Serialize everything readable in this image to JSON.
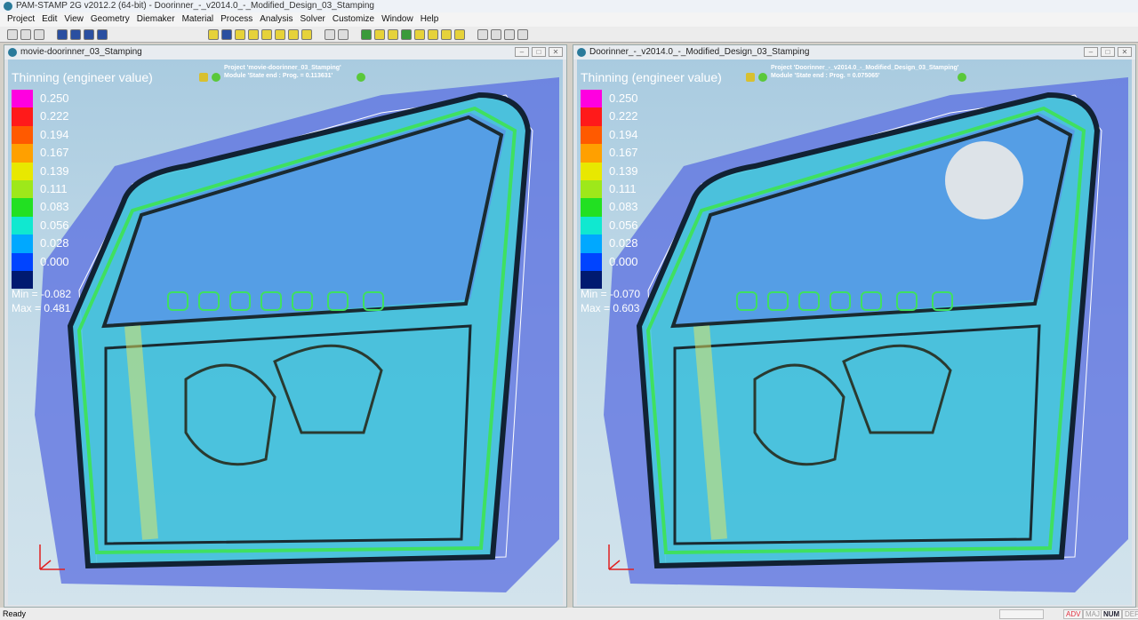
{
  "app_title": "PAM-STAMP 2G v2012.2 (64-bit) - Doorinner_-_v2014.0_-_Modified_Design_03_Stamping",
  "menu": [
    "Project",
    "Edit",
    "View",
    "Geometry",
    "Diemaker",
    "Material",
    "Process",
    "Analysis",
    "Solver",
    "Customize",
    "Window",
    "Help"
  ],
  "panels": [
    {
      "title": "movie-doorinner_03_Stamping",
      "result": "Thinning (engineer value)",
      "project": "Project 'movie-doorinner_03_Stamping'",
      "module": "Module 'State end : Prog. = 0.113631'",
      "min": "Min = -0.082",
      "max": "Max =  0.481"
    },
    {
      "title": "Doorinner_-_v2014.0_-_Modified_Design_03_Stamping",
      "result": "Thinning (engineer value)",
      "project": "Project 'Doorinner_-_v2014.0_-_Modified_Design_03_Stamping'",
      "module": "Module 'State end : Prog. = 0.075065'",
      "min": "Min = -0.070",
      "max": "Max =  0.603"
    }
  ],
  "legend": {
    "values": [
      "0.250",
      "0.222",
      "0.194",
      "0.167",
      "0.139",
      "0.111",
      "0.083",
      "0.056",
      "0.028",
      "0.000"
    ],
    "colors": [
      "#ff00e0",
      "#ff1a1a",
      "#ff5a00",
      "#ffa000",
      "#e8e800",
      "#9ee81a",
      "#22e022",
      "#10e8d0",
      "#00a8ff",
      "#0044ff",
      "#001a70"
    ]
  },
  "status": {
    "text": "Ready",
    "indicators": [
      "ADV",
      "MAJ",
      "NUM",
      "DEF"
    ]
  }
}
